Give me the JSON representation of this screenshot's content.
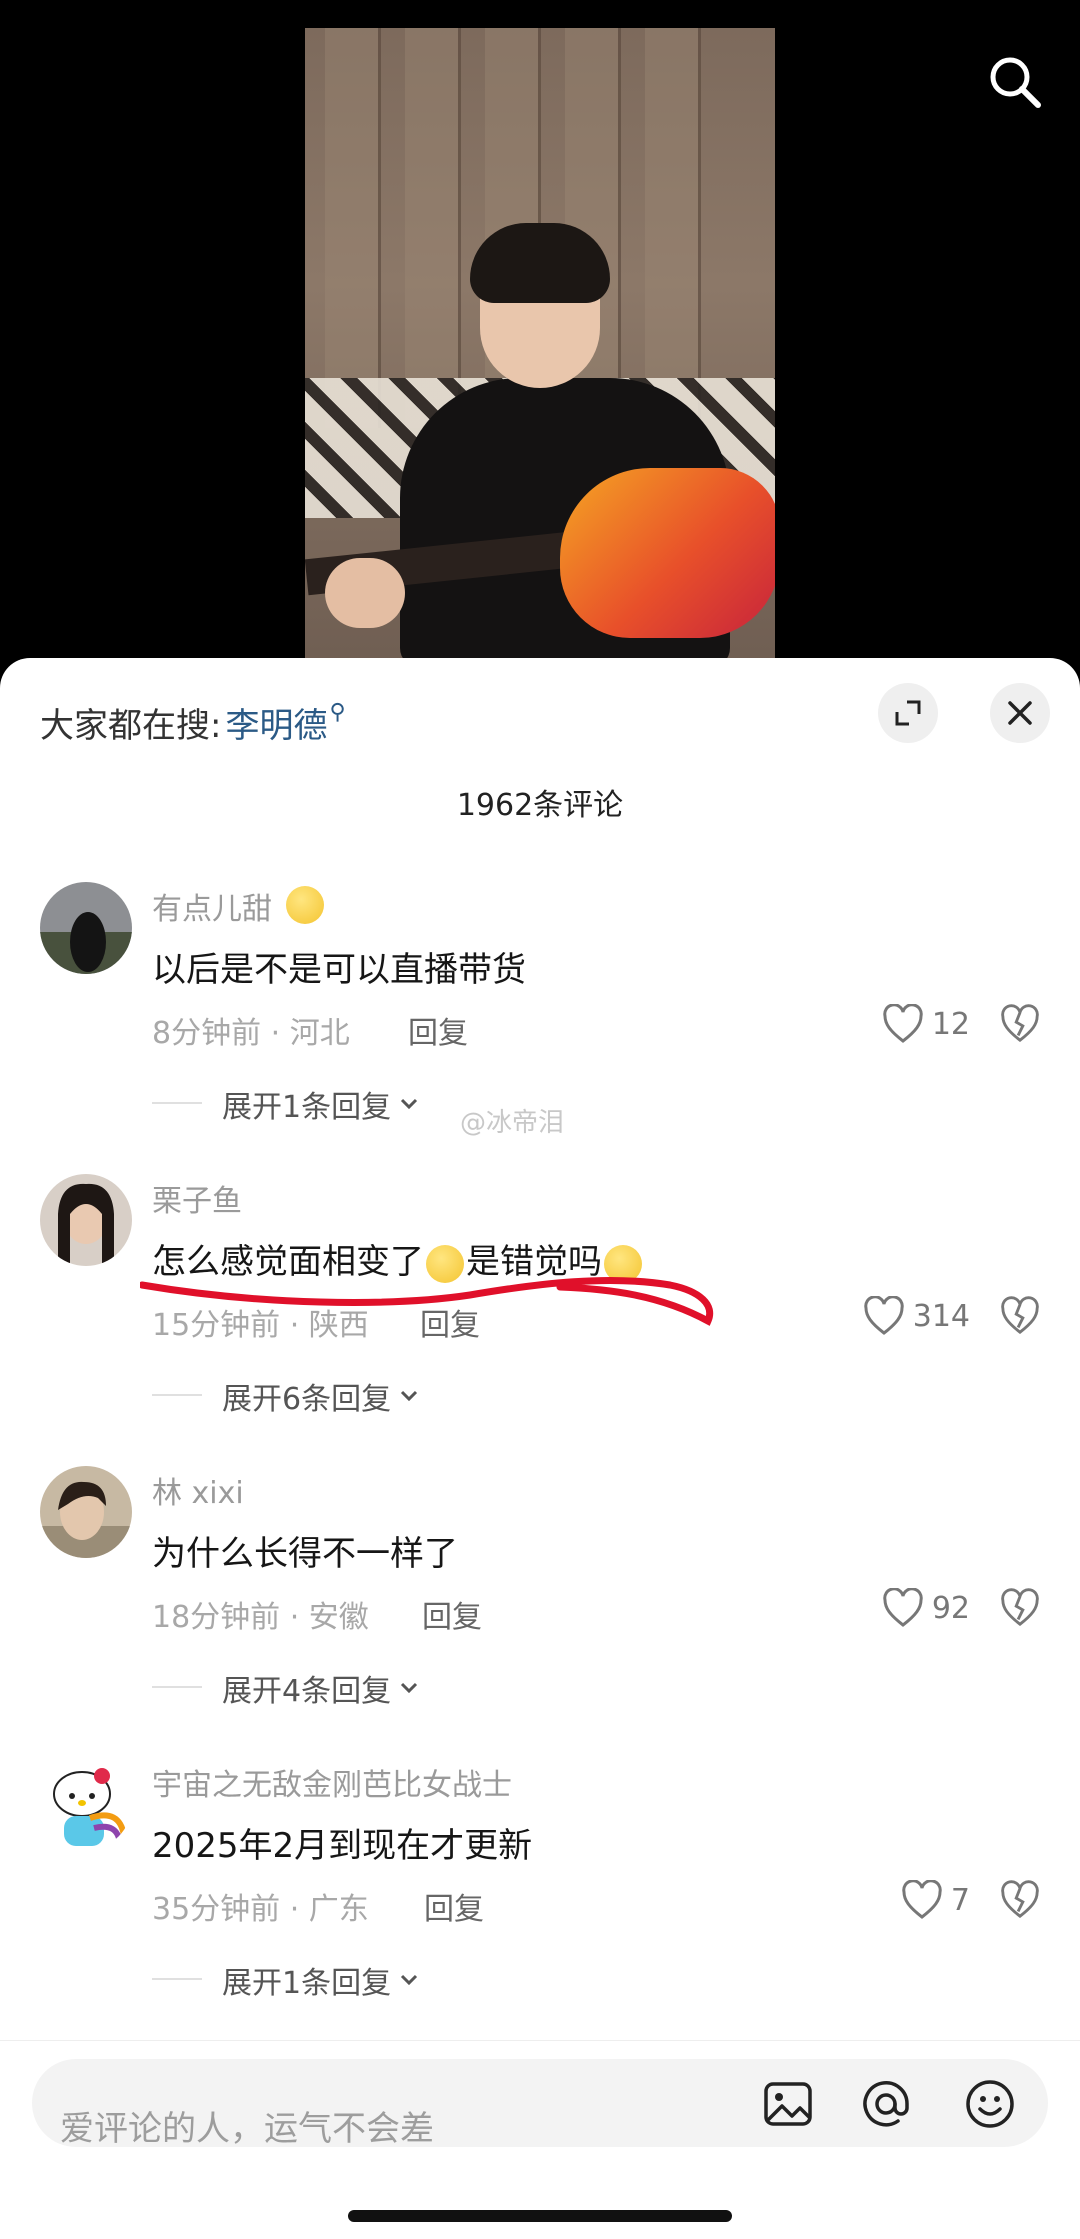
{
  "hot_search": {
    "prefix": "大家都在搜:",
    "term": "李明德"
  },
  "comment_count": "1962条评论",
  "watermark": "@冰帝泪",
  "comments": [
    {
      "username": "有点儿甜",
      "content": "以后是不是可以直播带货",
      "meta": "8分钟前 · 河北",
      "reply_label": "回复",
      "likes": "12",
      "expand": "展开1条回复"
    },
    {
      "username": "栗子鱼",
      "content_a": "怎么感觉面相变了",
      "content_b": "是错觉吗",
      "meta": "15分钟前 · 陕西",
      "reply_label": "回复",
      "likes": "314",
      "expand": "展开6条回复"
    },
    {
      "username": "林 xixi",
      "content": "为什么长得不一样了",
      "meta": "18分钟前 · 安徽",
      "reply_label": "回复",
      "likes": "92",
      "expand": "展开4条回复"
    },
    {
      "username": "宇宙之无敌金刚芭比女战士",
      "content": "2025年2月到现在才更新",
      "meta": "35分钟前 · 广东",
      "reply_label": "回复",
      "likes": "7",
      "expand": "展开1条回复"
    }
  ],
  "input": {
    "placeholder": "爱评论的人，运气不会差"
  },
  "icons": [
    "search-icon",
    "expand-icon",
    "close-icon",
    "heart-icon",
    "broken-heart-icon",
    "image-icon",
    "at-icon",
    "emoji-icon"
  ],
  "colors": {
    "accent": "#2b5a86",
    "annotation": "#e0102a"
  }
}
